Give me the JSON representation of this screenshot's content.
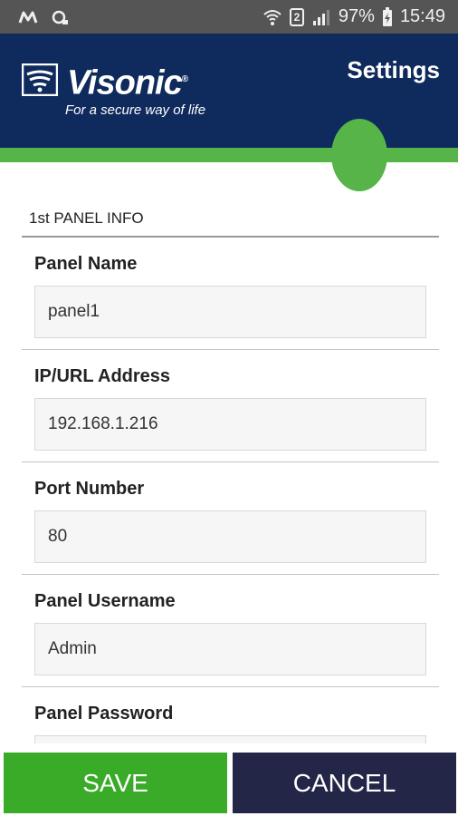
{
  "status_bar": {
    "battery": "97%",
    "time": "15:49",
    "sim_slot": "2",
    "icons": [
      "m-app-icon",
      "cloud-sync-icon",
      "wifi-icon",
      "signal-icon",
      "battery-charging-icon"
    ]
  },
  "header": {
    "brand": "Visonic",
    "tagline": "For a secure way of life",
    "title": "Settings",
    "colors": {
      "header_bg": "#0f2a5c",
      "accent_green": "#56b448"
    }
  },
  "section": {
    "title": "1st PANEL INFO"
  },
  "fields": [
    {
      "label": "Panel Name",
      "value": "panel1"
    },
    {
      "label": "IP/URL Address",
      "value": "192.168.1.216"
    },
    {
      "label": "Port Number",
      "value": "80"
    },
    {
      "label": "Panel Username",
      "value": "Admin"
    },
    {
      "label": "Panel Password",
      "value": ""
    }
  ],
  "buttons": {
    "save": "SAVE",
    "cancel": "CANCEL",
    "colors": {
      "save": "#3aaa29",
      "cancel": "#242648"
    }
  }
}
